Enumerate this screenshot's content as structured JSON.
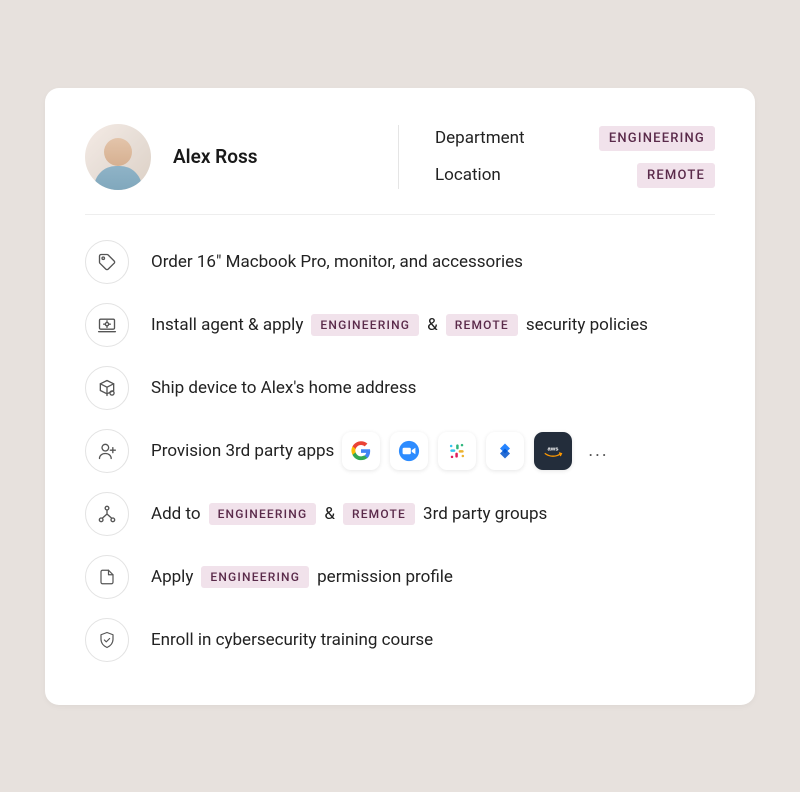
{
  "user": {
    "name": "Alex Ross"
  },
  "meta": {
    "department_label": "Department",
    "department_value": "ENGINEERING",
    "location_label": "Location",
    "location_value": "REMOTE"
  },
  "tags": {
    "engineering": "ENGINEERING",
    "remote": "REMOTE"
  },
  "tasks": {
    "order_device": "Order 16\" Macbook Pro, monitor, and accessories",
    "install_agent_prefix": "Install agent & apply",
    "install_agent_amp": "&",
    "install_agent_suffix": "security policies",
    "ship_device": "Ship device to Alex's home address",
    "provision_apps": "Provision 3rd party apps",
    "add_groups_prefix": "Add to",
    "add_groups_amp": "&",
    "add_groups_suffix": "3rd party groups",
    "apply_profile_prefix": "Apply",
    "apply_profile_suffix": "permission profile",
    "enroll_training": "Enroll in cybersecurity training course"
  },
  "apps": {
    "more": "..."
  }
}
